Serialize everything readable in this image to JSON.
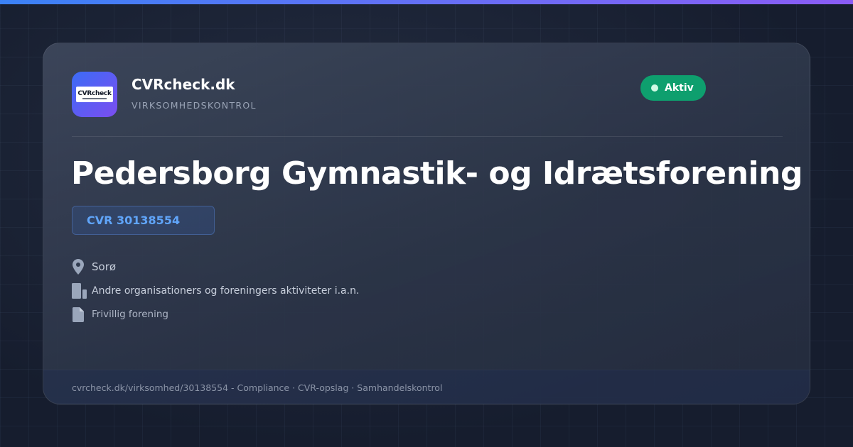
{
  "brand": {
    "logo_text": "CVRcheck",
    "name": "CVRcheck.dk",
    "tagline": "VIRKSOMHEDSKONTROL"
  },
  "status": {
    "label": "Aktiv",
    "color": "#0e9f6e"
  },
  "company": {
    "name": "Pedersborg Gymnastik- og Idrætsforening",
    "cvr": "CVR 30138554",
    "location": "Sorø",
    "industry": "Andre organisationers og foreningers aktiviteter i.a.n.",
    "company_type": "Frivillig forening"
  },
  "icons": {
    "location": "map-pin-icon",
    "industry": "building-icon",
    "company_type": "document-icon"
  },
  "footer": {
    "text": "cvrcheck.dk/virksomhed/30138554 - Compliance · CVR-opslag · Samhandelskontrol"
  },
  "colors": {
    "accent_blue": "#60a5fa",
    "status_green": "#0e9f6e",
    "background": "#161d2e"
  }
}
